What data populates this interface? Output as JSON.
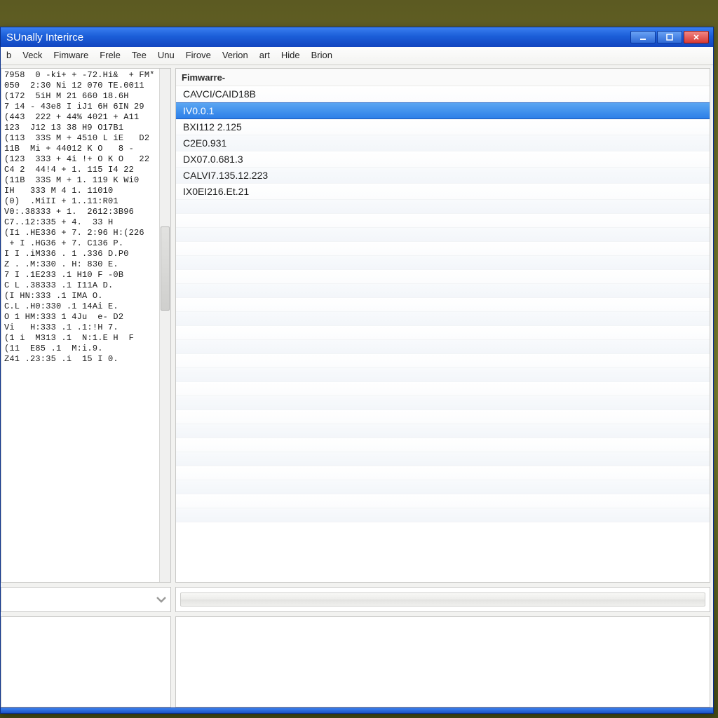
{
  "window": {
    "title": "SUnally Interirce"
  },
  "menu": {
    "items": [
      "b",
      "Veck",
      "Fimware",
      "Frele",
      "Tee",
      "Unu",
      "Firove",
      "Verion",
      "art",
      "Hide",
      "Brion"
    ]
  },
  "firmware": {
    "header": "Fimwarre-",
    "items": [
      "CAVCI/CAID18B",
      "IV0.0.1",
      "BXI112 2.125",
      "C2E0.931",
      "DX07.0.681.3",
      "CALVI7.135.12.223",
      "IX0EI216.Et.21"
    ],
    "selected_index": 1
  },
  "hex": {
    "lines": [
      "7958  0 -ki+ + -72.Hi&  + FM*",
      "050  2:30 Ni 12 070 TE.0011",
      "(172  5iH M 21 660 18.6H",
      "7 14 - 43e8 I iJ1 6H 6IN 29",
      "(443  222 + 44% 4021 + A11",
      "123  J12 13 38 H9 O17B1",
      "(113  33S M + 4510 L iE   D2",
      "11B  Mi + 44012 K O   8 -",
      "(123  333 + 4i !+ O K O   22",
      "C4 2  44!4 + 1. 115 I4 22",
      "(11B  33S M + 1. 119 K Wi0",
      "IH   333 M 4 1. 11010",
      "(0)  .MiII + 1..11:R01",
      "V0:.38333 + 1.  2612:3B96",
      "C7..12:335 + 4.  33 H",
      "(I1 .HE336 + 7. 2:96 H:(226",
      " + I .HG36 + 7. C136 P.",
      "I I .iM336 . 1 .336 D.P0",
      "Z . .M:330 . H: 830 E.",
      "7 I .1E233 .1 H10 F -0B",
      "C L .38333 .1 I11A D.",
      "(I HN:333 .1 IMA O.",
      "C.L .H0:330 .1 14Ai E.",
      "O 1 HM:333 1 4Ju  e- D2",
      "Vi   H:333 .1 .1:!H 7.",
      "(1 i  M313 .1  N:1.E H  F",
      "(11  E85 .1  M:i.9.",
      "Z41 .23:35 .i  15 I 0."
    ]
  }
}
